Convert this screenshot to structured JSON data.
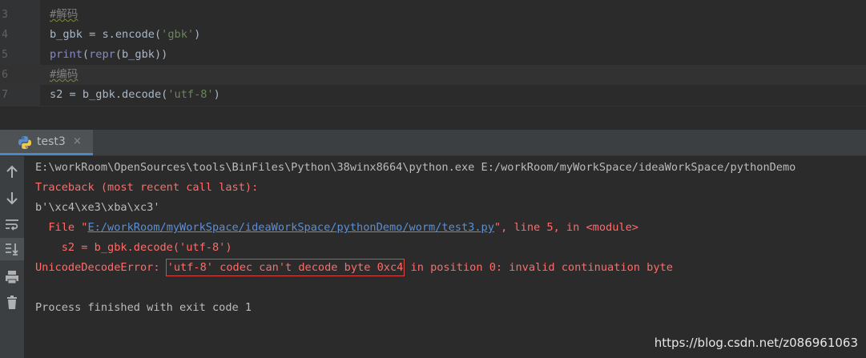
{
  "editor": {
    "lines": [
      {
        "num": "3",
        "text": "#解码",
        "current": false
      },
      {
        "num": "4",
        "parts": {
          "a": "b_gbk = s.encode(",
          "b": "'gbk'",
          "c": ")"
        },
        "current": false
      },
      {
        "num": "5",
        "parts": {
          "a": "print",
          "b": "(",
          "c": "repr",
          "d": "(b_gbk))"
        },
        "current": false
      },
      {
        "num": "6",
        "text": "#编码",
        "current": true
      },
      {
        "num": "7",
        "parts": {
          "a": "s2 = b_gbk.decode(",
          "b": "'utf-8'",
          "c": ")"
        },
        "current": false
      }
    ]
  },
  "run_tab": {
    "label": "test3",
    "close": "×"
  },
  "toolbar": {
    "icons": [
      "arrow-up-icon",
      "arrow-down-icon",
      "soft-wrap-icon",
      "scroll-to-end-icon",
      "print-icon",
      "trash-icon"
    ]
  },
  "console": {
    "cmd": "E:\\workRoom\\OpenSources\\tools\\BinFiles\\Python\\38winx8664\\python.exe E:/workRoom/myWorkSpace/ideaWorkSpace/pythonDemo",
    "traceback": "Traceback (most recent call last):",
    "bytes_out": "b'\\xc4\\xe3\\xba\\xc3'",
    "file_prefix": "  File \"",
    "file_link": "E:/workRoom/myWorkSpace/ideaWorkSpace/pythonDemo/worm/test3.py",
    "file_suffix": "\", line 5, in <module>",
    "code_line": "    s2 = b_gbk.decode('utf-8')",
    "error_name": "UnicodeDecodeError: ",
    "error_boxed": "'utf-8' codec can't decode byte 0xc4",
    "error_rest": " in position 0: invalid continuation byte",
    "finished": "Process finished with exit code 1"
  },
  "watermark": "https://blog.csdn.net/z086961063",
  "colors": {
    "editor_bg": "#2b2b2b",
    "gutter_bg": "#313335",
    "error_text": "#ff6b68",
    "link": "#5a8fd6",
    "highlight_box": "#e0463f",
    "tab_underline": "#4a88c7"
  }
}
